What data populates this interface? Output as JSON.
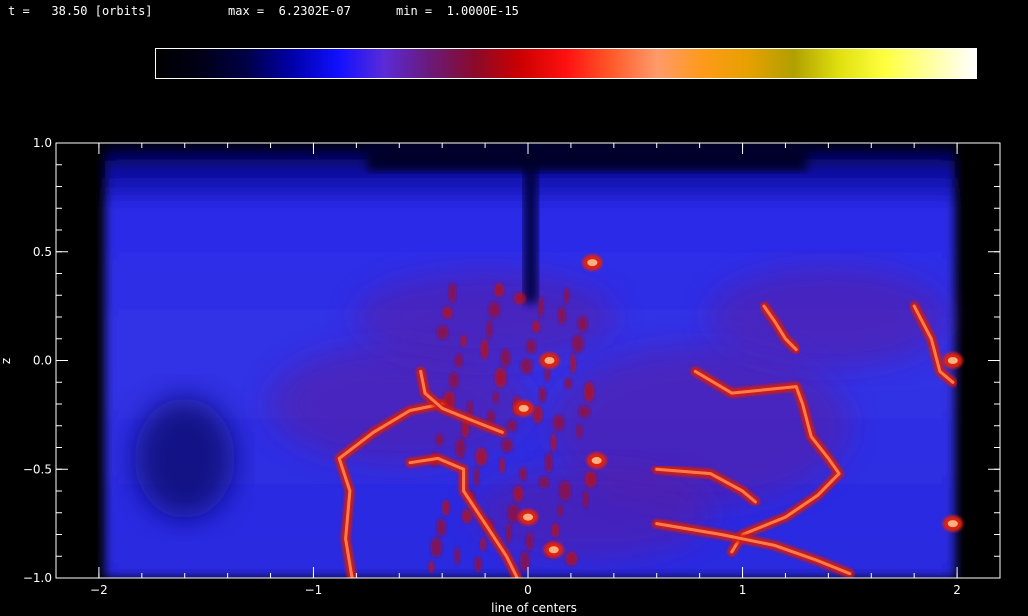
{
  "header": {
    "time_label": "t =",
    "time_value": "38.50",
    "time_unit": "[orbits]",
    "max_label": "max =",
    "max_value": "6.2302E-07",
    "min_label": "min =",
    "min_value": "1.0000E-15"
  },
  "colorbar": {
    "colors": [
      "#000000",
      "#000018",
      "#000048",
      "#0000aa",
      "#1010ff",
      "#5a2bd8",
      "#6a1a7a",
      "#8a0a2a",
      "#cc0000",
      "#ff1010",
      "#ff5a2a",
      "#ff9a6a",
      "#ff9a1a",
      "#e6a000",
      "#b0a000",
      "#e0e010",
      "#ffff40",
      "#ffffa0",
      "#ffffff"
    ]
  },
  "chart_data": {
    "type": "heatmap",
    "title": "",
    "xlabel": "line of centers",
    "ylabel": "z",
    "xlim": [
      -2.2,
      2.2
    ],
    "ylim": [
      -1.0,
      1.0
    ],
    "x_ticks": [
      -2,
      -1,
      0,
      1,
      2
    ],
    "x_tick_labels": [
      "−2",
      "−1",
      "0",
      "1",
      "2"
    ],
    "y_ticks": [
      -1.0,
      -0.5,
      0.0,
      0.5,
      1.0
    ],
    "y_tick_labels": [
      "−1.0",
      "−0.5",
      "0.0",
      "0.5",
      "1.0"
    ],
    "x_minor_step": 0.2,
    "y_minor_step": 0.1,
    "grid": false,
    "colormap": "black-blue-red-yellow-white",
    "value_range": [
      1e-15,
      6.2302e-07
    ],
    "features": [
      {
        "shape": "filament",
        "points": [
          [
            -0.82,
            -1.0
          ],
          [
            -0.85,
            -0.82
          ],
          [
            -0.83,
            -0.6
          ],
          [
            -0.88,
            -0.45
          ],
          [
            -0.72,
            -0.33
          ],
          [
            -0.55,
            -0.23
          ],
          [
            -0.4,
            -0.2
          ]
        ]
      },
      {
        "shape": "filament",
        "points": [
          [
            -0.55,
            -0.47
          ],
          [
            -0.42,
            -0.45
          ],
          [
            -0.3,
            -0.5
          ],
          [
            -0.3,
            -0.6
          ],
          [
            -0.2,
            -0.75
          ],
          [
            -0.1,
            -0.9
          ],
          [
            -0.05,
            -1.0
          ]
        ]
      },
      {
        "shape": "filament",
        "points": [
          [
            -0.5,
            -0.05
          ],
          [
            -0.48,
            -0.15
          ],
          [
            -0.4,
            -0.22
          ],
          [
            -0.25,
            -0.28
          ],
          [
            -0.12,
            -0.33
          ]
        ]
      },
      {
        "shape": "filament",
        "points": [
          [
            0.78,
            -0.05
          ],
          [
            0.95,
            -0.15
          ],
          [
            1.25,
            -0.12
          ],
          [
            1.28,
            -0.2
          ],
          [
            1.32,
            -0.35
          ],
          [
            1.4,
            -0.45
          ],
          [
            1.45,
            -0.52
          ],
          [
            1.35,
            -0.62
          ],
          [
            1.2,
            -0.72
          ],
          [
            1.0,
            -0.8
          ],
          [
            0.95,
            -0.88
          ]
        ]
      },
      {
        "shape": "filament",
        "points": [
          [
            1.1,
            0.25
          ],
          [
            1.15,
            0.18
          ],
          [
            1.2,
            0.1
          ],
          [
            1.25,
            0.05
          ]
        ]
      },
      {
        "shape": "filament",
        "points": [
          [
            0.6,
            -0.75
          ],
          [
            0.9,
            -0.8
          ],
          [
            1.15,
            -0.85
          ],
          [
            1.35,
            -0.92
          ],
          [
            1.5,
            -0.98
          ]
        ]
      },
      {
        "shape": "filament",
        "points": [
          [
            1.8,
            0.25
          ],
          [
            1.88,
            0.1
          ],
          [
            1.92,
            -0.05
          ],
          [
            1.98,
            -0.1
          ]
        ]
      },
      {
        "shape": "filament",
        "points": [
          [
            0.6,
            -0.5
          ],
          [
            0.85,
            -0.52
          ],
          [
            1.0,
            -0.6
          ],
          [
            1.06,
            -0.65
          ]
        ]
      },
      {
        "shape": "blob",
        "points": [
          [
            0.32,
            -0.46
          ],
          [
            0.1,
            0.0
          ],
          [
            0.3,
            0.45
          ],
          [
            1.98,
            0.0
          ],
          [
            1.98,
            -0.75
          ],
          [
            0.0,
            -0.72
          ],
          [
            0.12,
            -0.87
          ],
          [
            -0.02,
            -0.22
          ]
        ]
      }
    ]
  }
}
